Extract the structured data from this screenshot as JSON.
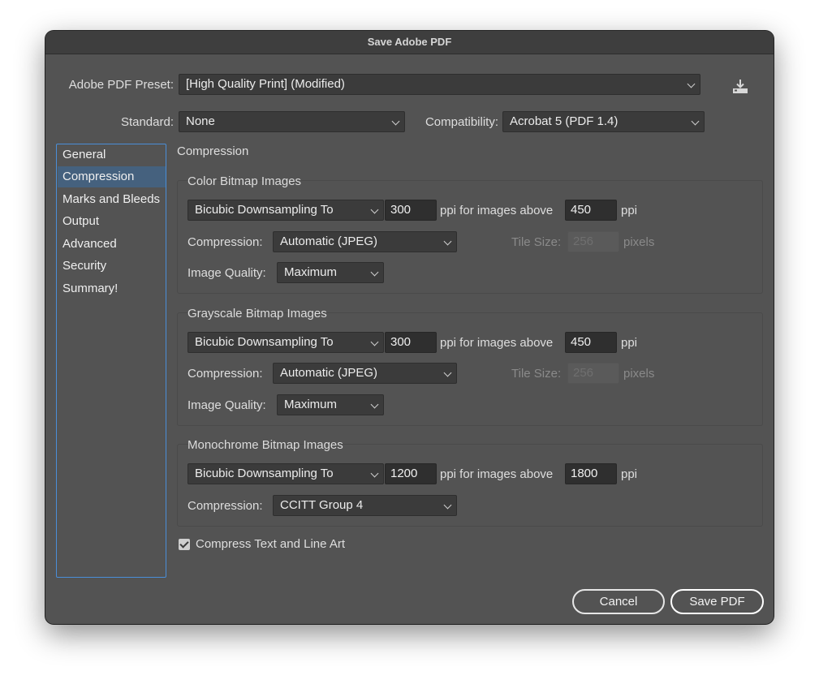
{
  "window": {
    "title": "Save Adobe PDF"
  },
  "preset": {
    "label": "Adobe PDF Preset:",
    "value": "[High Quality Print] (Modified)"
  },
  "save_preset_icon": "download-tray-icon",
  "standard": {
    "label": "Standard:",
    "value": "None"
  },
  "compatibility": {
    "label": "Compatibility:",
    "value": "Acrobat 5 (PDF 1.4)"
  },
  "sidebar": {
    "items": [
      {
        "label": "General"
      },
      {
        "label": "Compression"
      },
      {
        "label": "Marks and Bleeds"
      },
      {
        "label": "Output"
      },
      {
        "label": "Advanced"
      },
      {
        "label": "Security"
      },
      {
        "label": "Summary!"
      }
    ],
    "active": "Compression"
  },
  "panel": {
    "title": "Compression"
  },
  "color_bitmap": {
    "title": "Color Bitmap Images",
    "downsampling": "Bicubic Downsampling To",
    "ppi": "300",
    "ppi_above_label": "ppi for images above",
    "above_value": "450",
    "ppi_unit": "ppi",
    "compression_label": "Compression:",
    "compression": "Automatic (JPEG)",
    "tile_label": "Tile Size:",
    "tile_value": "256",
    "tile_unit": "pixels",
    "quality_label": "Image Quality:",
    "quality": "Maximum"
  },
  "grayscale_bitmap": {
    "title": "Grayscale Bitmap Images",
    "downsampling": "Bicubic Downsampling To",
    "ppi": "300",
    "ppi_above_label": "ppi for images above",
    "above_value": "450",
    "ppi_unit": "ppi",
    "compression_label": "Compression:",
    "compression": "Automatic (JPEG)",
    "tile_label": "Tile Size:",
    "tile_value": "256",
    "tile_unit": "pixels",
    "quality_label": "Image Quality:",
    "quality": "Maximum"
  },
  "mono_bitmap": {
    "title": "Monochrome Bitmap Images",
    "downsampling": "Bicubic Downsampling To",
    "ppi": "1200",
    "ppi_above_label": "ppi for images above",
    "above_value": "1800",
    "ppi_unit": "ppi",
    "compression_label": "Compression:",
    "compression": "CCITT Group 4"
  },
  "compress_text": {
    "label": "Compress Text and Line Art",
    "checked": true
  },
  "buttons": {
    "cancel": "Cancel",
    "save": "Save PDF"
  },
  "colors": {
    "accent": "#4a8ed8",
    "selected": "#45617e",
    "background": "#535353"
  }
}
